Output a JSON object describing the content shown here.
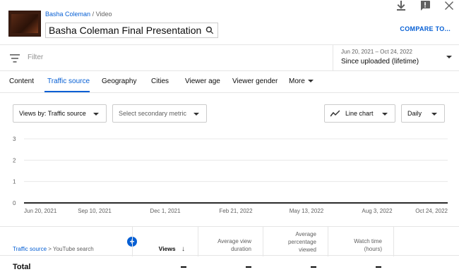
{
  "top_icons": [
    "download-icon",
    "feedback-icon",
    "close-icon"
  ],
  "header": {
    "breadcrumb_channel": "Basha Coleman",
    "breadcrumb_sep": "/",
    "breadcrumb_type": "Video",
    "video_title": "Basha Coleman Final Presentation",
    "compare_label": "COMPARE TO..."
  },
  "filter": {
    "placeholder": "Filter",
    "date_range": "Jun 20, 2021 – Oct 24, 2022",
    "date_preset": "Since uploaded (lifetime)"
  },
  "tabs": [
    {
      "label": "Content",
      "active": false
    },
    {
      "label": "Traffic source",
      "active": true
    },
    {
      "label": "Geography",
      "active": false
    },
    {
      "label": "Cities",
      "active": false
    },
    {
      "label": "Viewer age",
      "active": false
    },
    {
      "label": "Viewer gender",
      "active": false
    },
    {
      "label": "More",
      "active": false
    }
  ],
  "controls": {
    "views_by": "Views by: Traffic source",
    "secondary_metric": "Select secondary metric",
    "chart_type": "Line chart",
    "interval": "Daily"
  },
  "chart_data": {
    "type": "line",
    "y_ticks": [
      "3",
      "2",
      "1",
      "0"
    ],
    "x_ticks": [
      "Jun 20, 2021",
      "Sep 10, 2021",
      "Dec 1, 2021",
      "Feb 21, 2022",
      "May 13, 2022",
      "Aug 3, 2022",
      "Oct 24, 2022"
    ],
    "ylim": [
      0,
      3
    ],
    "series": [
      {
        "values": [
          0,
          0,
          0,
          0,
          0,
          0,
          0
        ]
      }
    ],
    "grid": true
  },
  "table": {
    "breadcrumb_root": "Traffic source",
    "breadcrumb_sep": ">",
    "breadcrumb_current": "YouTube search",
    "add_symbol": "+",
    "columns": {
      "views": "Views",
      "sort_arrow": "↓",
      "avg_view_duration_1": "Average view",
      "avg_view_duration_2": "duration",
      "avg_pct_1": "Average",
      "avg_pct_2": "percentage",
      "avg_pct_3": "viewed",
      "watch_time_1": "Watch time",
      "watch_time_2": "(hours)"
    },
    "total_label": "Total"
  }
}
